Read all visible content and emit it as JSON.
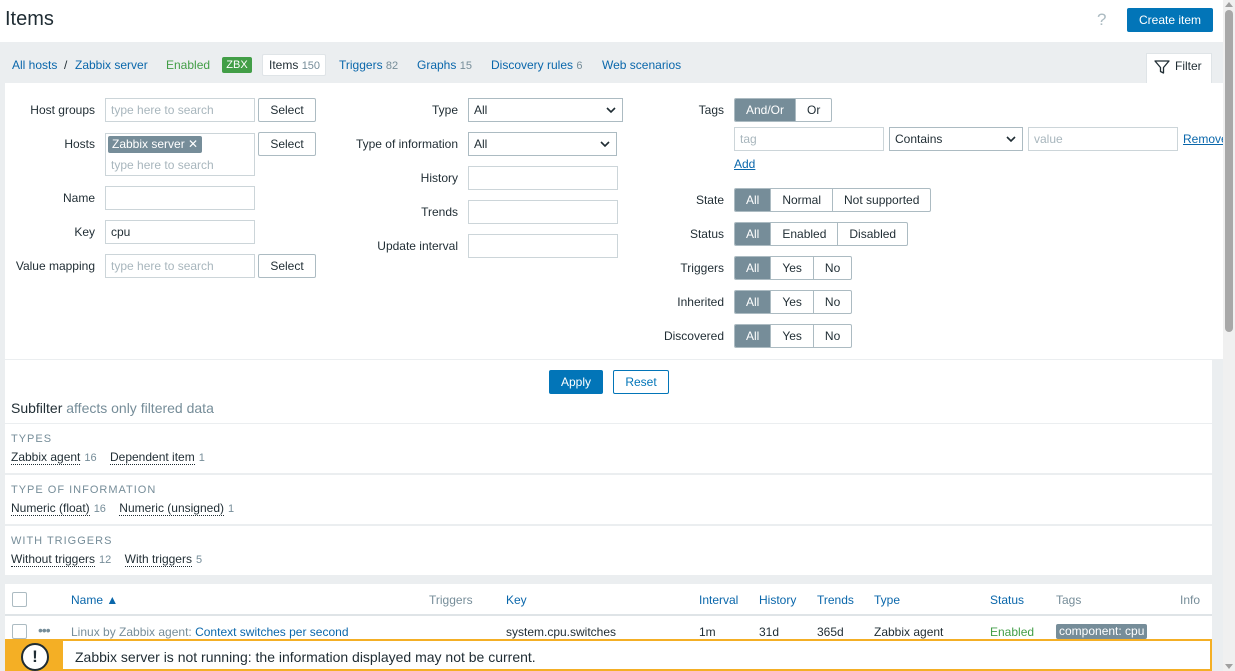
{
  "header": {
    "title": "Items",
    "help": "?",
    "create_button": "Create item"
  },
  "nav": {
    "all_hosts": "All hosts",
    "separator": "/",
    "host": "Zabbix server",
    "status": "Enabled",
    "badge": "ZBX",
    "items_label": "Items",
    "items_count": "150",
    "triggers_label": "Triggers",
    "triggers_count": "82",
    "graphs_label": "Graphs",
    "graphs_count": "15",
    "discovery_label": "Discovery rules",
    "discovery_count": "6",
    "web_label": "Web scenarios",
    "filter_label": "Filter"
  },
  "filter": {
    "host_groups_label": "Host groups",
    "host_groups_placeholder": "type here to search",
    "hosts_label": "Hosts",
    "host_chip": "Zabbix server",
    "hosts_placeholder": "type here to search",
    "name_label": "Name",
    "name_value": "",
    "key_label": "Key",
    "key_value": "cpu",
    "value_mapping_label": "Value mapping",
    "value_mapping_placeholder": "type here to search",
    "select_label": "Select",
    "type_label": "Type",
    "type_value": "All",
    "type_info_label": "Type of information",
    "type_info_value": "All",
    "history_label": "History",
    "trends_label": "Trends",
    "update_interval_label": "Update interval",
    "tags_label": "Tags",
    "tags_andor": "And/Or",
    "tags_or": "Or",
    "tag_placeholder": "tag",
    "tag_operator": "Contains",
    "value_placeholder": "value",
    "remove_label": "Remove",
    "add_label": "Add",
    "state_label": "State",
    "state_all": "All",
    "state_normal": "Normal",
    "state_not_supported": "Not supported",
    "status_label": "Status",
    "status_all": "All",
    "status_enabled": "Enabled",
    "status_disabled": "Disabled",
    "triggers_label": "Triggers",
    "inherited_label": "Inherited",
    "discovered_label": "Discovered",
    "all": "All",
    "yes": "Yes",
    "no": "No",
    "apply": "Apply",
    "reset": "Reset"
  },
  "subfilter": {
    "title": "Subfilter",
    "note": "affects only filtered data",
    "types_head": "TYPES",
    "types": [
      {
        "label": "Zabbix agent",
        "count": "16"
      },
      {
        "label": "Dependent item",
        "count": "1"
      }
    ],
    "type_info_head": "TYPE OF INFORMATION",
    "type_info": [
      {
        "label": "Numeric (float)",
        "count": "16"
      },
      {
        "label": "Numeric (unsigned)",
        "count": "1"
      }
    ],
    "with_triggers_head": "WITH TRIGGERS",
    "with_triggers": [
      {
        "label": "Without triggers",
        "count": "12"
      },
      {
        "label": "With triggers",
        "count": "5"
      }
    ]
  },
  "table": {
    "columns": {
      "name": "Name ▲",
      "triggers": "Triggers",
      "key": "Key",
      "interval": "Interval",
      "history": "History",
      "trends": "Trends",
      "type": "Type",
      "status": "Status",
      "tags": "Tags",
      "info": "Info"
    },
    "row": {
      "template": "Linux by Zabbix agent:",
      "name": "Context switches per second",
      "key": "system.cpu.switches",
      "interval": "1m",
      "history": "31d",
      "trends": "365d",
      "type": "Zabbix agent",
      "status": "Enabled",
      "tag": "component: cpu"
    }
  },
  "warning": {
    "icon": "!",
    "text": "Zabbix server is not running: the information displayed may not be current."
  },
  "colors": {
    "primary": "#0275b8",
    "enabled": "#429e47",
    "warning": "#f4af25",
    "chip": "#768d99"
  }
}
